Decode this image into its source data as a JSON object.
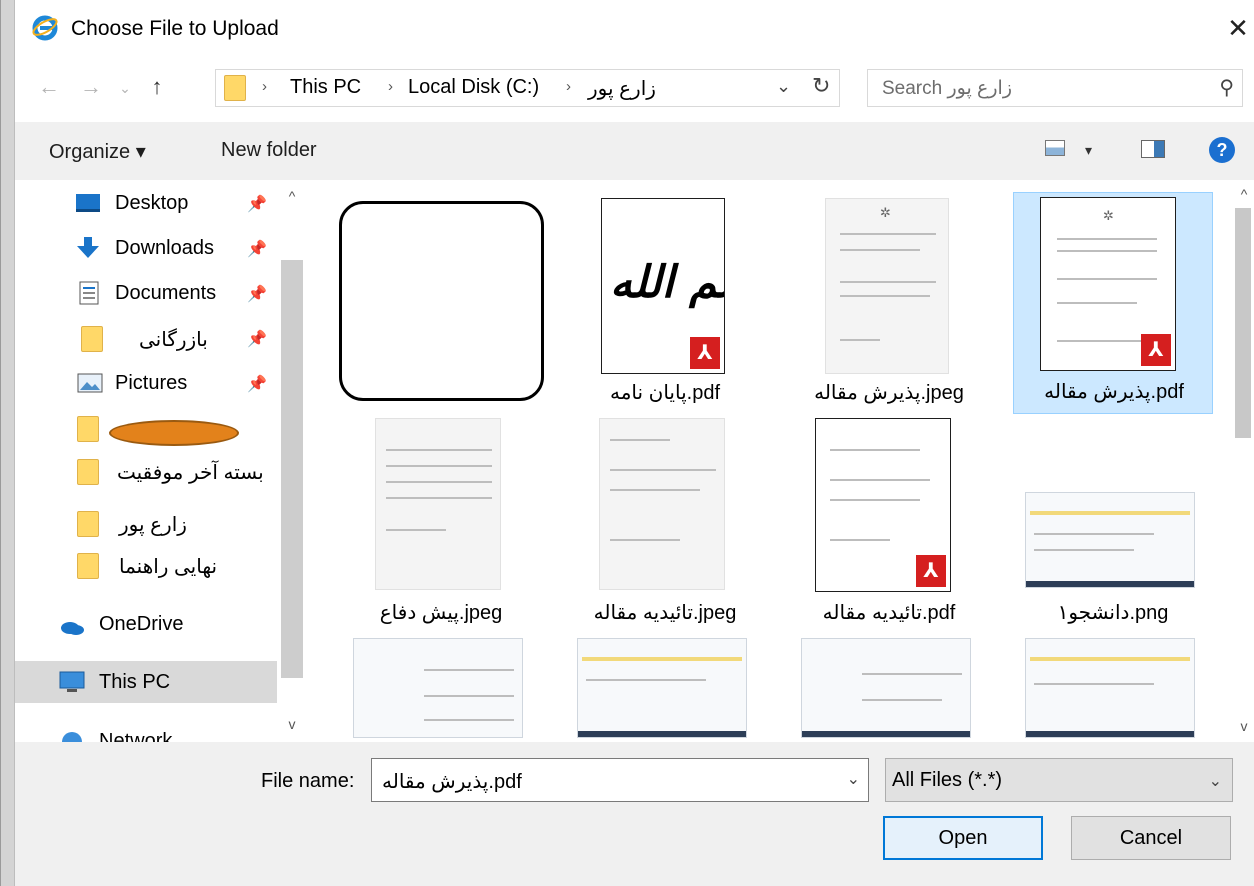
{
  "window": {
    "title": "Choose File to Upload",
    "close_glyph": "✕"
  },
  "nav": {
    "back_glyph": "←",
    "forward_glyph": "→",
    "recent_glyph": "⌄",
    "up_glyph": "↑",
    "breadcrumbs": [
      "This PC",
      "Local Disk (C:)",
      "زارع پور"
    ],
    "separator": "›",
    "dropdown_glyph": "⌄",
    "refresh_glyph": "↻",
    "search_placeholder": "Search زارع پور",
    "search_glyph": "⚲"
  },
  "toolbar": {
    "organize_label": "Organize ▾",
    "new_folder_label": "New folder",
    "view_arrow": "▾",
    "help_glyph": "?"
  },
  "sidebar": {
    "pin_glyph": "📌",
    "items": [
      {
        "label": "Desktop",
        "icon": "desktop-icon",
        "pinned": true
      },
      {
        "label": "Downloads",
        "icon": "downloads-icon",
        "pinned": true
      },
      {
        "label": "Documents",
        "icon": "documents-icon",
        "pinned": true
      },
      {
        "label": "بازرگانی",
        "icon": "folder-icon",
        "pinned": true
      },
      {
        "label": "Pictures",
        "icon": "pictures-icon",
        "pinned": true
      },
      {
        "label": "",
        "icon": "folder-icon",
        "pinned": false
      },
      {
        "label": "بسته آخر موفقیت",
        "icon": "folder-icon",
        "pinned": false
      },
      {
        "label": "زارع پور",
        "icon": "folder-icon",
        "pinned": false
      },
      {
        "label": "نهایی راهنما",
        "icon": "folder-icon",
        "pinned": false
      },
      {
        "label": "OneDrive",
        "icon": "onedrive-icon",
        "pinned": false
      },
      {
        "label": "This PC",
        "icon": "this-pc-icon",
        "pinned": false,
        "selected": true
      },
      {
        "label": "Network",
        "icon": "network-icon",
        "pinned": false
      }
    ]
  },
  "files": [
    {
      "name": "",
      "type": "hidden"
    },
    {
      "name": "پایان نامه.pdf",
      "type": "pdf",
      "thumb_text": "بسم الله"
    },
    {
      "name": "پذیرش مقاله.jpeg",
      "type": "jpeg"
    },
    {
      "name": "پذیرش مقاله.pdf",
      "type": "pdf",
      "selected": true
    },
    {
      "name": "پیش دفاع.jpeg",
      "type": "jpeg"
    },
    {
      "name": "تائیدیه مقاله.jpeg",
      "type": "jpeg"
    },
    {
      "name": "تائیدیه مقاله.pdf",
      "type": "pdf"
    },
    {
      "name": "دانشجو۱.png",
      "type": "png"
    },
    {
      "name": "",
      "type": "png"
    },
    {
      "name": "",
      "type": "png"
    },
    {
      "name": "",
      "type": "png"
    },
    {
      "name": "",
      "type": "png"
    }
  ],
  "bottom": {
    "file_name_label": "File name:",
    "file_name_value": "پذیرش مقاله.pdf",
    "file_type_value": "All Files (*.*)",
    "drop_glyph": "⌄",
    "open_label": "Open",
    "cancel_label": "Cancel"
  },
  "colors": {
    "accent": "#0078d7",
    "selection": "#cce8ff",
    "folder": "#ffd868",
    "pdf": "#d51f1f"
  }
}
